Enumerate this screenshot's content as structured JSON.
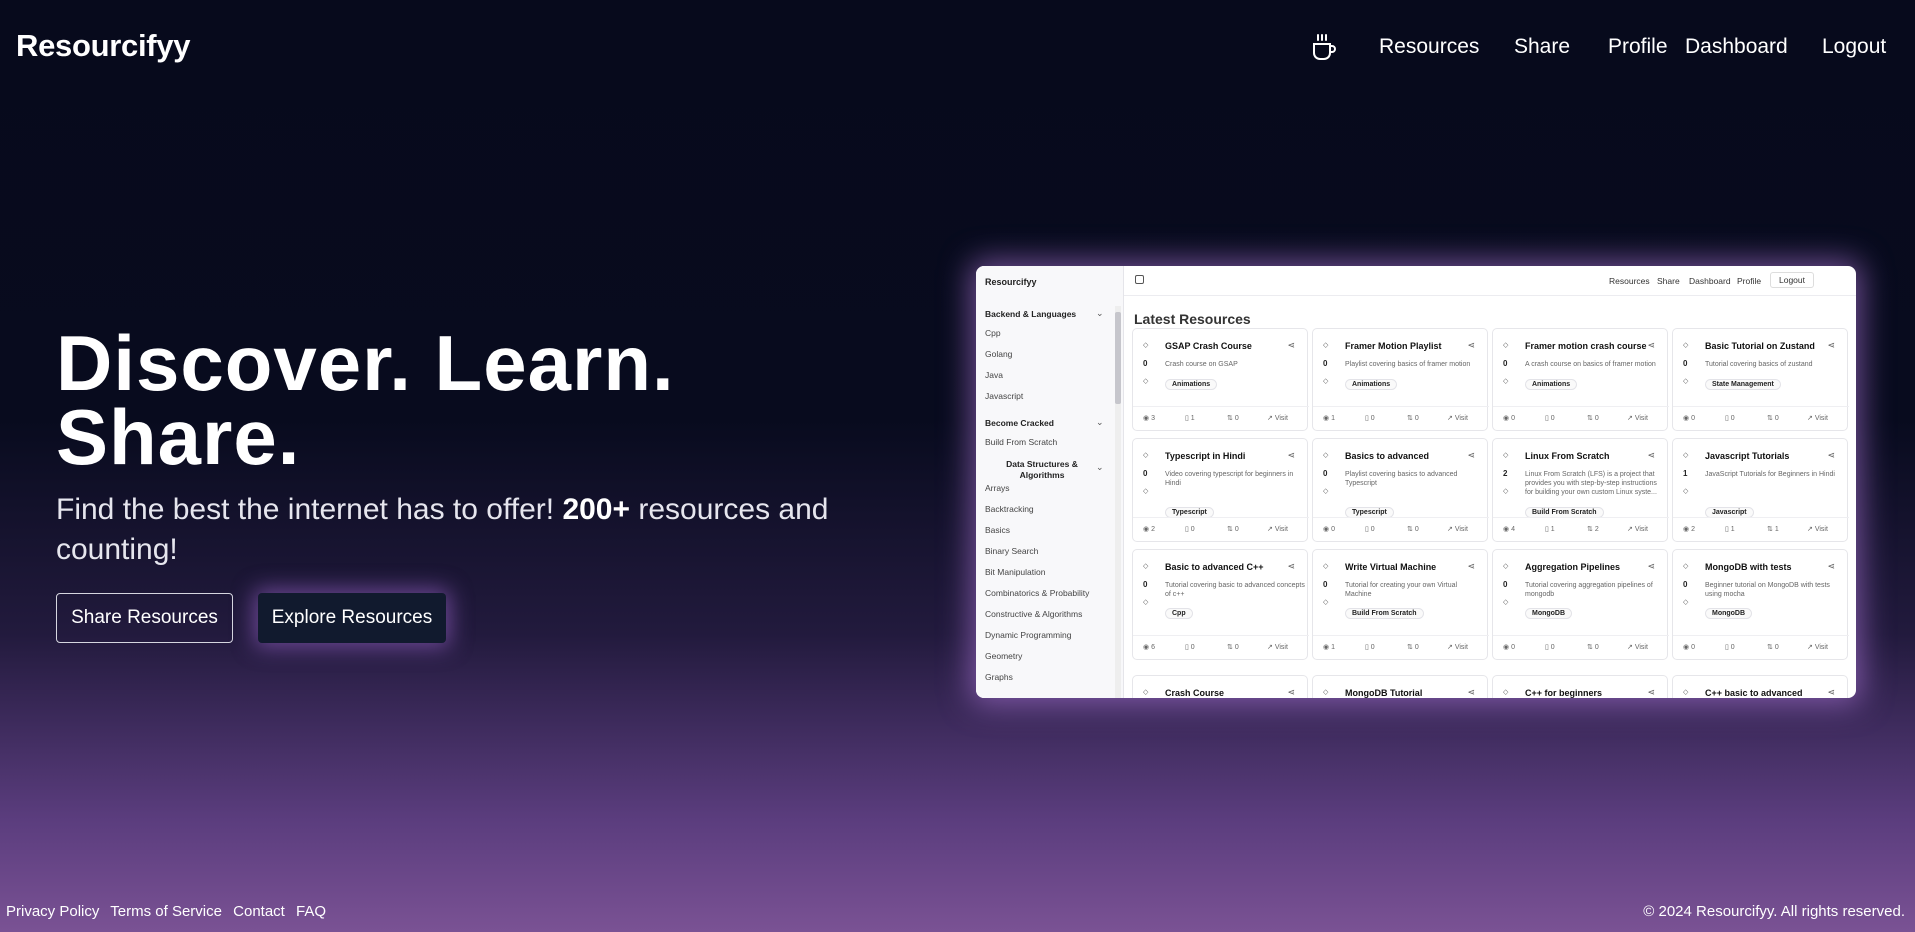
{
  "header": {
    "brand": "Resourcifyy",
    "nav": [
      "Resources",
      "Share",
      "Profile",
      "Dashboard",
      "Logout"
    ]
  },
  "hero": {
    "title_line1": "Discover. Learn.",
    "title_line2": "Share.",
    "subtitle_pre": "Find the best the internet has to offer! ",
    "subtitle_bold": "200+",
    "subtitle_post": " resources and counting!",
    "share_button": "Share Resources",
    "explore_button": "Explore Resources"
  },
  "preview": {
    "brand": "Resourcifyy",
    "nav": [
      "Resources",
      "Share",
      "Dashboard",
      "Profile",
      "Logout"
    ],
    "heading": "Latest Resources",
    "sidebar": {
      "group1": "Backend & Languages",
      "group1_items": [
        "Cpp",
        "Golang",
        "Java",
        "Javascript"
      ],
      "group2": "Become Cracked",
      "group2_items": [
        "Build From Scratch"
      ],
      "sub_group": "Data Structures & Algorithms",
      "dsa_items": [
        "Arrays",
        "Backtracking",
        "Basics",
        "Binary Search",
        "Bit Manipulation",
        "Combinatorics & Probability",
        "Constructive & Algorithms",
        "Dynamic Programming",
        "Geometry",
        "Graphs"
      ]
    },
    "cards": [
      {
        "title": "GSAP Crash Course",
        "votes": "0",
        "desc": "Crash course on GSAP",
        "tag": "Animations",
        "views": "3",
        "saves": "1",
        "comments": "0",
        "visit": "Visit"
      },
      {
        "title": "Framer Motion Playlist",
        "votes": "0",
        "desc": "Playlist covering basics of framer motion",
        "tag": "Animations",
        "views": "1",
        "saves": "0",
        "comments": "0",
        "visit": "Visit"
      },
      {
        "title": "Framer motion crash course",
        "votes": "0",
        "desc": "A crash course on basics of framer motion",
        "tag": "Animations",
        "views": "0",
        "saves": "0",
        "comments": "0",
        "visit": "Visit"
      },
      {
        "title": "Basic Tutorial on Zustand",
        "votes": "0",
        "desc": "Tutorial covering basics of zustand",
        "tag": "State Management",
        "views": "0",
        "saves": "0",
        "comments": "0",
        "visit": "Visit"
      },
      {
        "title": "Typescript in Hindi",
        "votes": "0",
        "desc": "Video covering typescript for beginners in Hindi",
        "tag": "Typescript",
        "views": "2",
        "saves": "0",
        "comments": "0",
        "visit": "Visit"
      },
      {
        "title": "Basics to advanced",
        "votes": "0",
        "desc": "Playlist covering basics to advanced Typescript",
        "tag": "Typescript",
        "views": "0",
        "saves": "0",
        "comments": "0",
        "visit": "Visit"
      },
      {
        "title": "Linux From Scratch",
        "votes": "2",
        "desc": "Linux From Scratch (LFS) is a project that provides you with step-by-step instructions for building your own custom Linux syste...",
        "tag": "Build From Scratch",
        "views": "4",
        "saves": "1",
        "comments": "2",
        "visit": "Visit"
      },
      {
        "title": "Javascript Tutorials",
        "votes": "1",
        "desc": "JavaScript Tutorials for Beginners in Hindi",
        "tag": "Javascript",
        "views": "2",
        "saves": "1",
        "comments": "1",
        "visit": "Visit"
      },
      {
        "title": "Basic to advanced C++",
        "votes": "0",
        "desc": "Tutorial covering basic to advanced concepts of c++",
        "tag": "Cpp",
        "views": "6",
        "saves": "0",
        "comments": "0",
        "visit": "Visit"
      },
      {
        "title": "Write Virtual Machine",
        "votes": "0",
        "desc": "Tutorial for creating your own Virtual Machine",
        "tag": "Build From Scratch",
        "views": "1",
        "saves": "0",
        "comments": "0",
        "visit": "Visit"
      },
      {
        "title": "Aggregation Pipelines",
        "votes": "0",
        "desc": "Tutorial covering aggregation pipelines of mongodb",
        "tag": "MongoDB",
        "views": "0",
        "saves": "0",
        "comments": "0",
        "visit": "Visit"
      },
      {
        "title": "MongoDB with tests",
        "votes": "0",
        "desc": "Beginner tutorial on MongoDB with tests using mocha",
        "tag": "MongoDB",
        "views": "0",
        "saves": "0",
        "comments": "0",
        "visit": "Visit"
      },
      {
        "title": "Crash Course",
        "votes": "",
        "desc": "",
        "tag": "",
        "views": "",
        "saves": "",
        "comments": "",
        "visit": ""
      },
      {
        "title": "MongoDB Tutorial",
        "votes": "",
        "desc": "",
        "tag": "",
        "views": "",
        "saves": "",
        "comments": "",
        "visit": ""
      },
      {
        "title": "C++ for beginners",
        "votes": "",
        "desc": "",
        "tag": "",
        "views": "",
        "saves": "",
        "comments": "",
        "visit": ""
      },
      {
        "title": "C++ basic to advanced",
        "votes": "",
        "desc": "",
        "tag": "",
        "views": "",
        "saves": "",
        "comments": "",
        "visit": ""
      }
    ]
  },
  "footer": {
    "links": [
      "Privacy Policy",
      "Terms of Service",
      "Contact",
      "FAQ"
    ],
    "copyright": "© 2024 Resourcifyy. All rights reserved."
  }
}
